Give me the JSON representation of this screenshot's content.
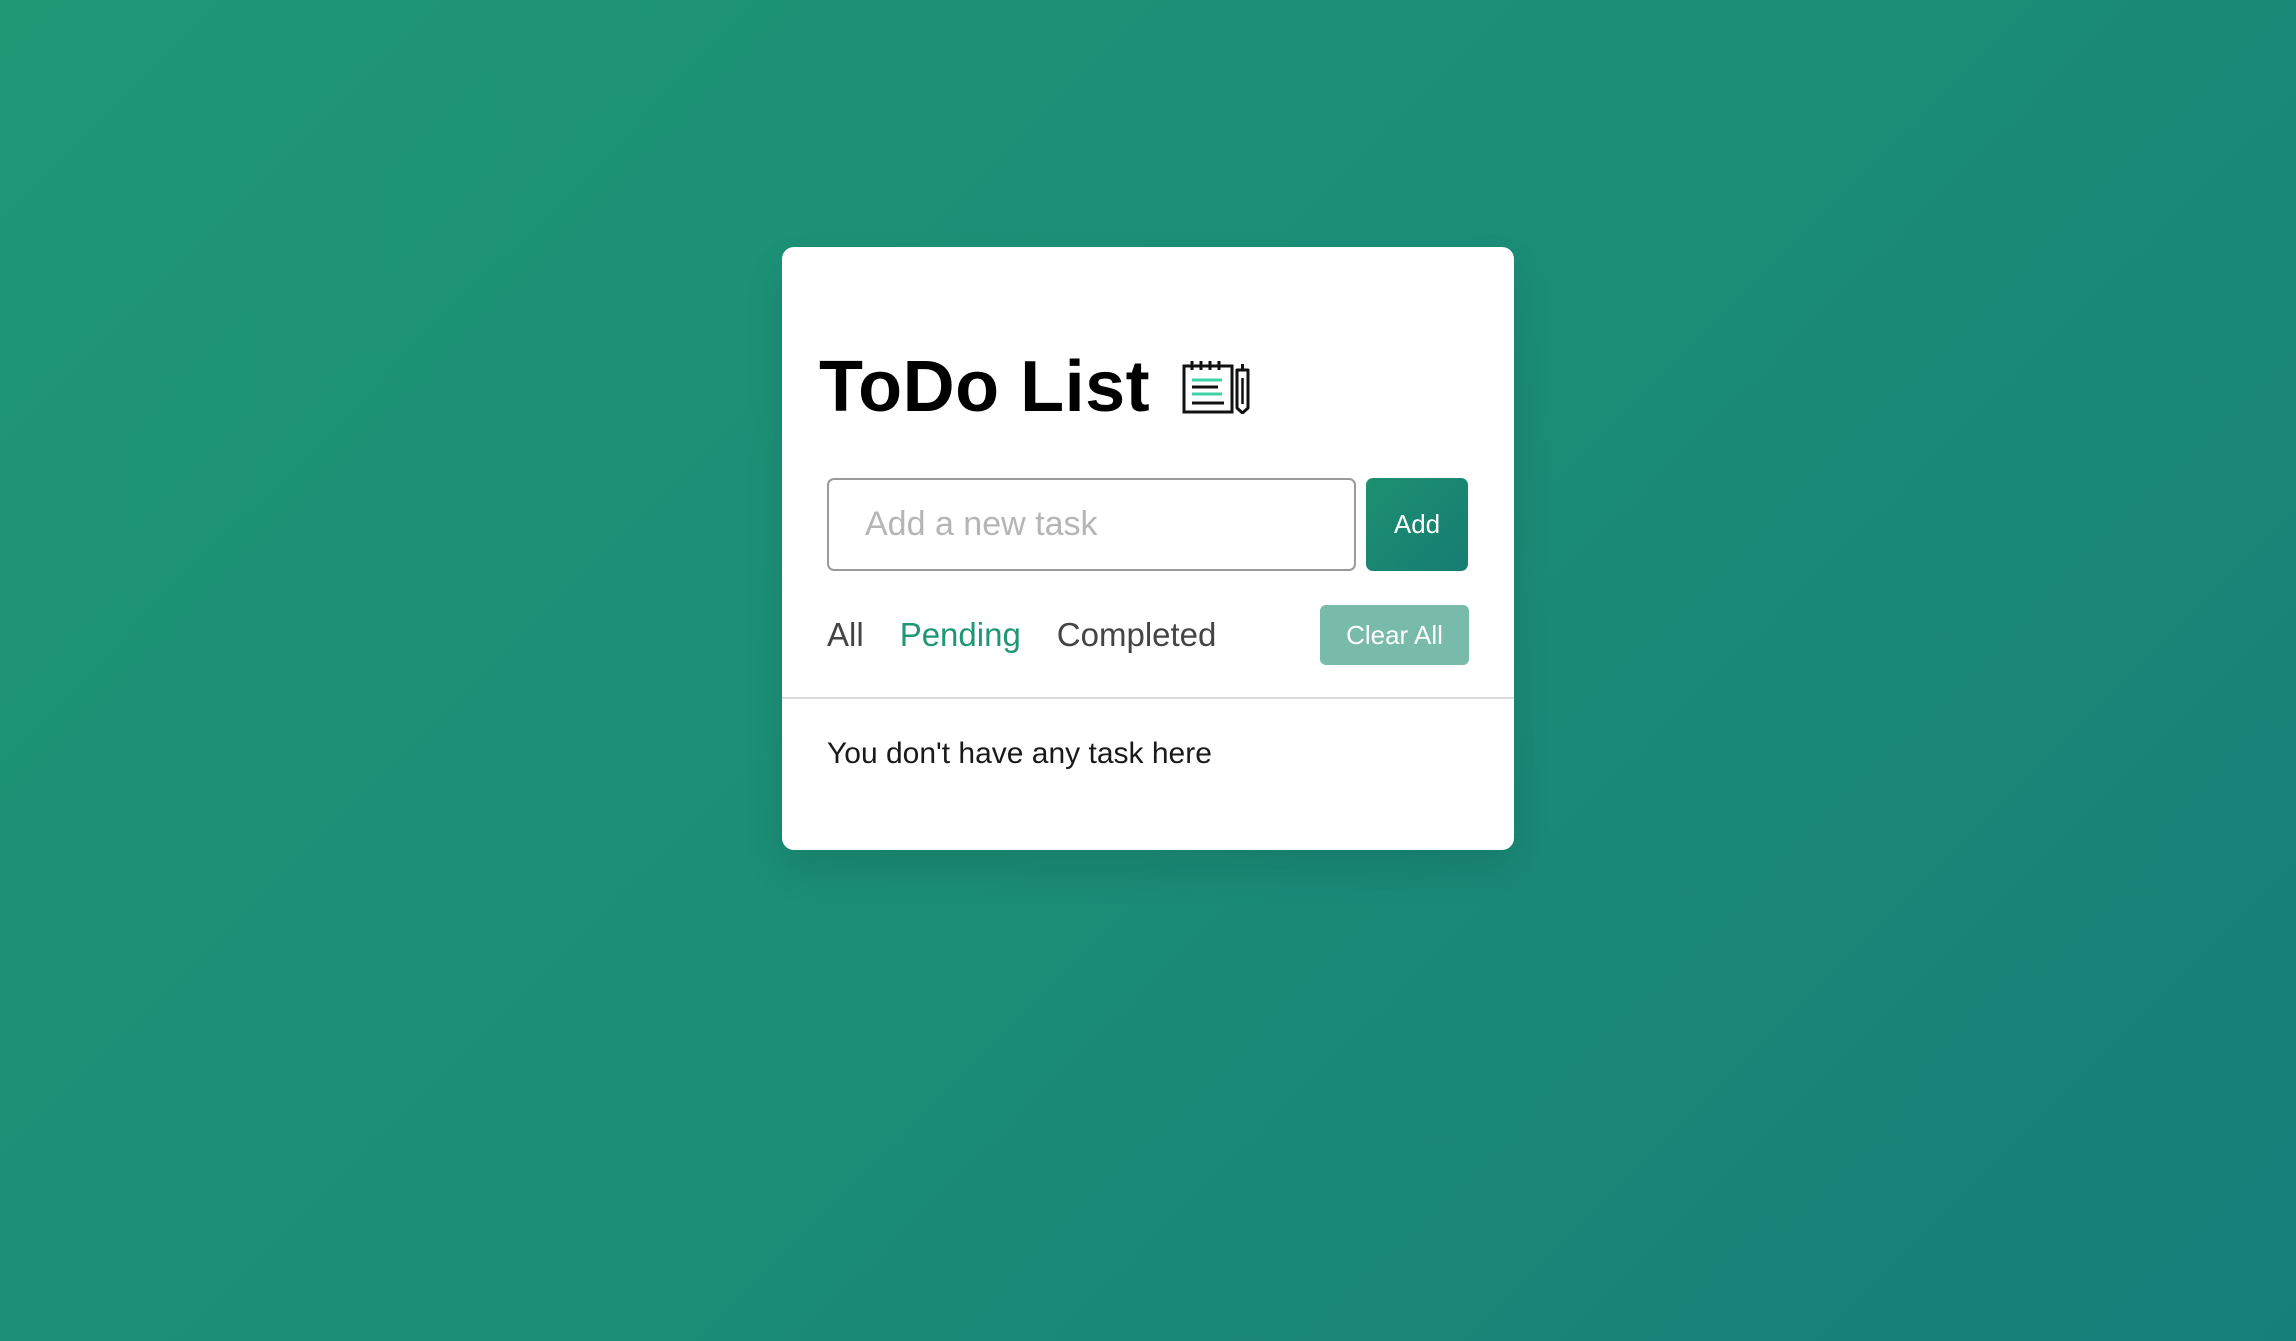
{
  "app": {
    "title": "ToDo List",
    "title_icon": "notepad-pencil-icon"
  },
  "input": {
    "placeholder": "Add a new task",
    "value": ""
  },
  "buttons": {
    "add_label": "Add",
    "clear_label": "Clear All"
  },
  "filters": [
    {
      "label": "All",
      "active": false
    },
    {
      "label": "Pending",
      "active": true
    },
    {
      "label": "Completed",
      "active": false
    }
  ],
  "tasks": {
    "empty_message": "You don't have any task here"
  },
  "colors": {
    "accent": "#1f9775",
    "background_start": "#1f9775",
    "background_end": "#177f7a",
    "clear_button": "#79bbaa"
  }
}
